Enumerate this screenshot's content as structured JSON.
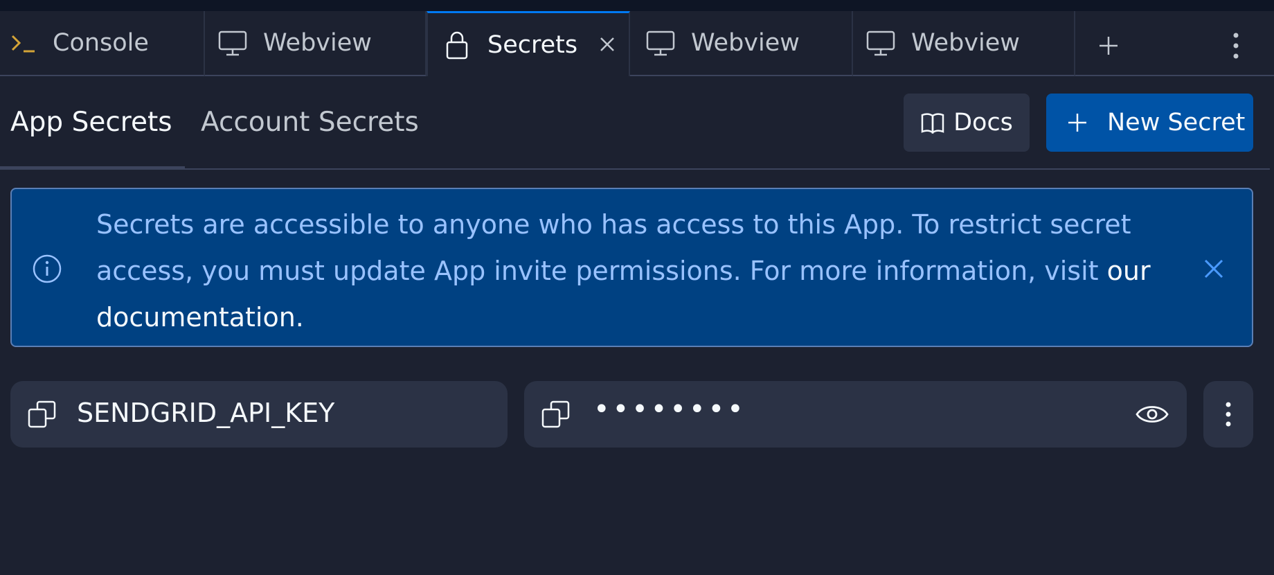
{
  "colors": {
    "background": "#1c2130",
    "surface": "#2b3245",
    "accent": "#0079f2",
    "primary_button": "#0053a6",
    "banner_background": "#004182",
    "banner_text": "#99c2ff",
    "console_prompt": "#d4a437"
  },
  "tabs": [
    {
      "label": "Console",
      "icon": "terminal-icon",
      "active": false
    },
    {
      "label": "Webview",
      "icon": "monitor-icon",
      "active": false
    },
    {
      "label": "Secrets",
      "icon": "lock-icon",
      "active": true,
      "closable": true
    },
    {
      "label": "Webview",
      "icon": "monitor-icon",
      "active": false
    },
    {
      "label": "Webview",
      "icon": "monitor-icon",
      "active": false
    }
  ],
  "tabbar": {
    "add_icon": "plus-icon",
    "menu_icon": "more-vertical-icon"
  },
  "subtabs": [
    {
      "label": "App Secrets",
      "active": true
    },
    {
      "label": "Account Secrets",
      "active": false
    }
  ],
  "toolbar": {
    "docs_label": "Docs",
    "docs_icon": "book-icon",
    "new_secret_label": "New Secret",
    "new_secret_icon": "plus-icon"
  },
  "banner": {
    "text": "Secrets are accessible to anyone who has access to this App. To restrict secret access, you must update App invite permissions. For more information, visit ",
    "link_text": "our documentation.",
    "info_icon": "info-icon",
    "close_icon": "close-icon"
  },
  "secrets": [
    {
      "key": "SENDGRID_API_KEY",
      "masked_value": "••••••••"
    }
  ]
}
